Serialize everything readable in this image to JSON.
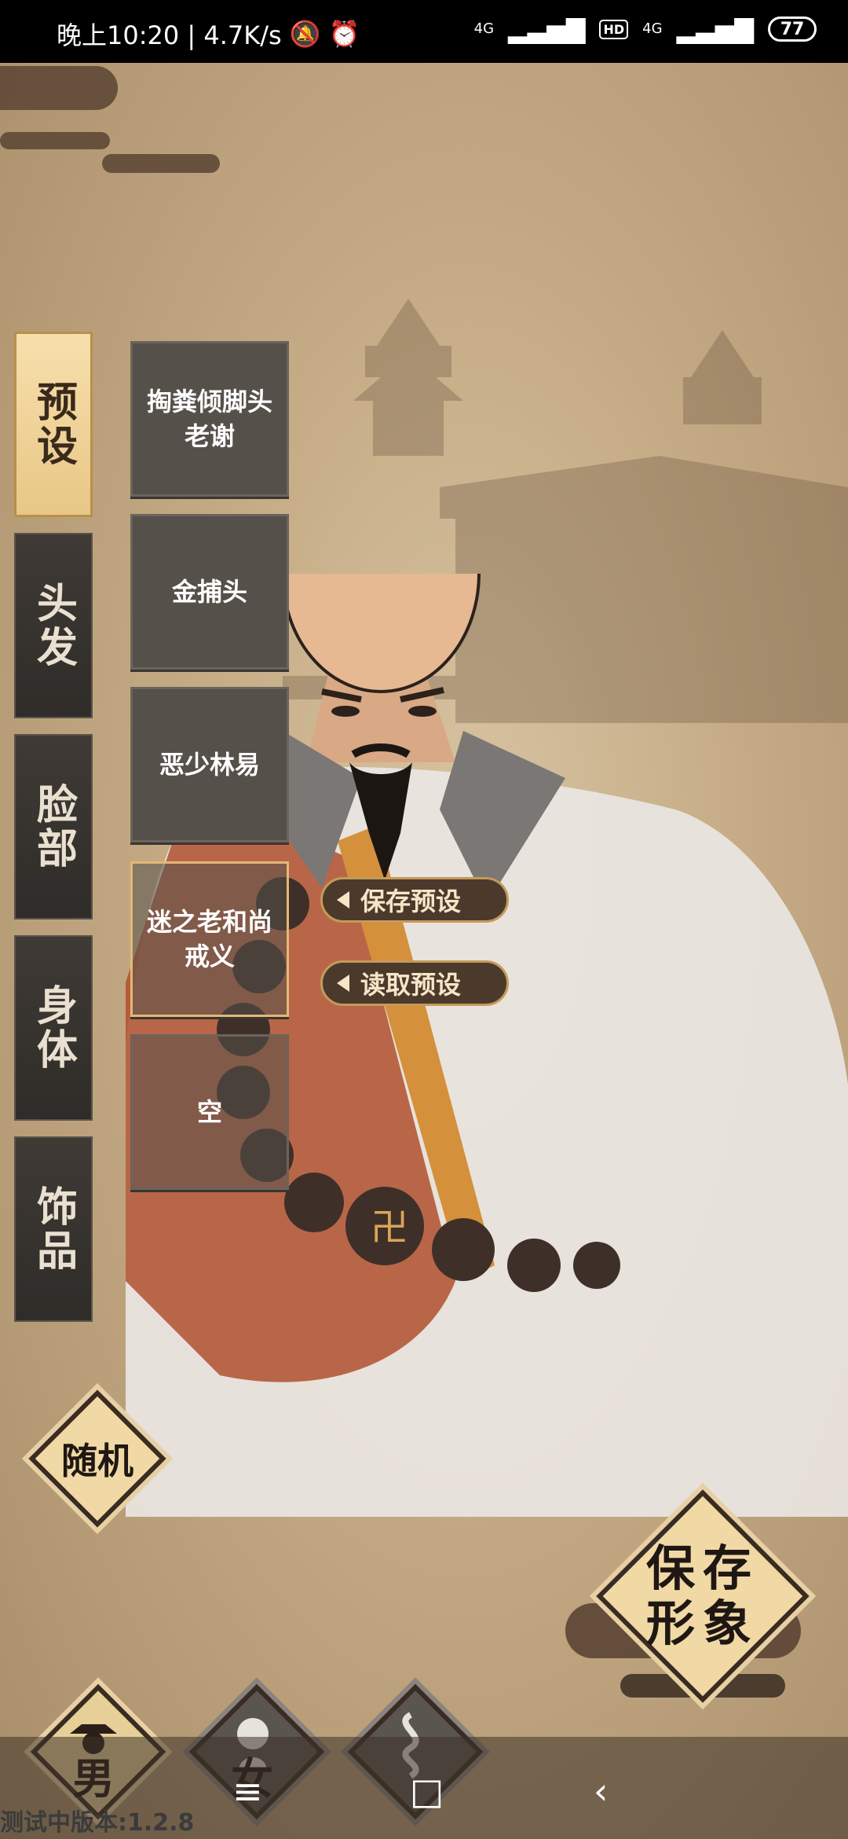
{
  "status_bar": {
    "time_speed": "晚上10:20 | 4.7K/s",
    "mute_icon": "bell-off-icon",
    "alarm_icon": "alarm-clock-icon",
    "network_1": "4G",
    "hd": "HD",
    "network_2": "4G",
    "battery": "77"
  },
  "categories": [
    {
      "label": "预设",
      "active": true
    },
    {
      "label": "头发",
      "active": false
    },
    {
      "label": "脸部",
      "active": false
    },
    {
      "label": "身体",
      "active": false
    },
    {
      "label": "饰品",
      "active": false
    }
  ],
  "presets": [
    {
      "label": "掏粪倾脚头老谢"
    },
    {
      "label": "金捕头"
    },
    {
      "label": "恶少林易"
    },
    {
      "label": "迷之老和尚戒义",
      "selected": true
    },
    {
      "label": "空"
    }
  ],
  "actions": {
    "save_preset": "保存预设",
    "load_preset": "读取预设"
  },
  "random_button": "随机",
  "save_look_button": "保存形象",
  "genders": [
    {
      "label": "男",
      "selected": true
    },
    {
      "label": "女",
      "selected": false
    },
    {
      "label": "",
      "selected": false
    }
  ],
  "nav": {
    "menu_icon": "≡",
    "home_icon": "□",
    "back_icon": "‹"
  },
  "version": "测试中版本:1.2.8",
  "colors": {
    "accent": "#e3b873",
    "panel": "#55504a",
    "background": "#c9b18e"
  }
}
